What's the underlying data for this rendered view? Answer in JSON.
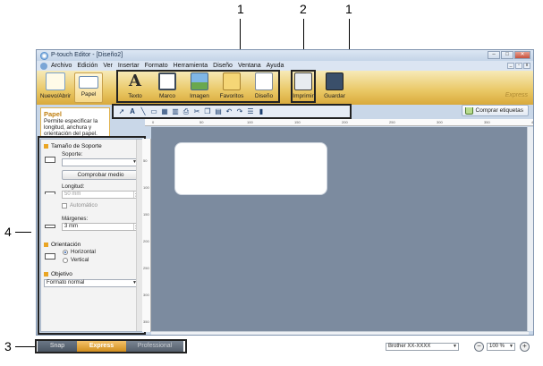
{
  "callouts": {
    "top_left": "1",
    "top_mid": "2",
    "top_right": "1",
    "left": "4",
    "bottom": "3"
  },
  "window": {
    "title": "P-touch Editor - [Diseño2]"
  },
  "menu": [
    "Archivo",
    "Edición",
    "Ver",
    "Insertar",
    "Formato",
    "Herramienta",
    "Diseño",
    "Ventana",
    "Ayuda"
  ],
  "ribbon": {
    "nuevo_abrir": "Nuevo/Abrir",
    "papel": "Papel",
    "texto": "Texto",
    "marco": "Marco",
    "imagen": "Imagen",
    "favoritos": "Favoritos",
    "diseno": "Diseño",
    "imprimir": "Imprimir",
    "guardar": "Guardar",
    "express": "Express"
  },
  "toolbar": {
    "buy_label": "Comprar etiquetas"
  },
  "info": {
    "heading": "Papel",
    "description": "Permite especificar la longitud, anchura y orientación del papel."
  },
  "panel": {
    "tamano": "Tamaño de Soporte",
    "soporte": "Soporte:",
    "soporte_value": "",
    "comprobar": "Comprobar medio",
    "longitud": "Longitud:",
    "longitud_value": "50 mm",
    "automatico": "Automático",
    "margenes": "Márgenes:",
    "margenes_value": "3 mm",
    "orientacion": "Orientación",
    "horizontal": "Horizontal",
    "vertical": "Vertical",
    "objetivo": "Objetivo",
    "formato": "Formato normal"
  },
  "ruler": {
    "h": [
      "0",
      "50",
      "100",
      "150",
      "200",
      "250",
      "300",
      "350",
      "400"
    ],
    "v": [
      "50",
      "100",
      "150",
      "200",
      "250",
      "300",
      "350"
    ]
  },
  "status": {
    "printer": "Brother XX-XXXX",
    "zoom": "100 %"
  },
  "modes": {
    "snap": "Snap",
    "express": "Express",
    "professional": "Professional"
  },
  "colors": {
    "ribbon": "#e9c764",
    "express_mode": "#d18e1c",
    "canvas": "#7c8b9f"
  }
}
